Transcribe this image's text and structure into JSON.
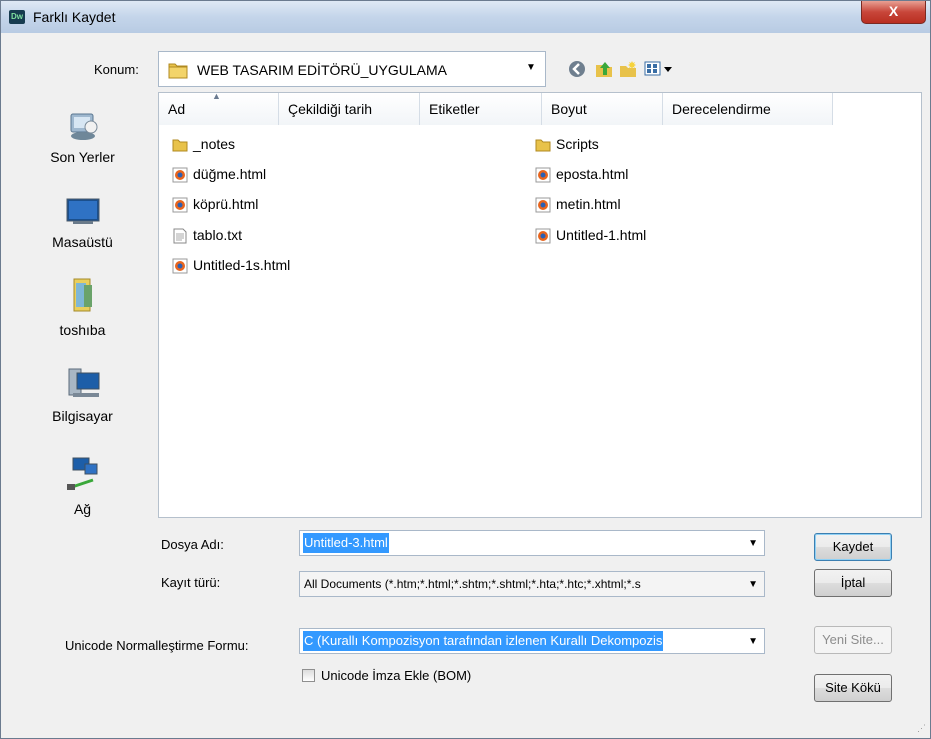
{
  "window": {
    "title": "Farklı Kaydet",
    "logo_text": "Dw",
    "close_glyph": "X"
  },
  "location": {
    "label": "Konum:",
    "value": "WEB TASARIM EDİTÖRÜ_UYGULAMA"
  },
  "toolbar_icons": [
    "back-icon",
    "up-folder-icon",
    "new-folder-icon",
    "view-menu-icon"
  ],
  "places": [
    {
      "label": "Son Yerler",
      "icon": "recent-places-icon"
    },
    {
      "label": "Masaüstü",
      "icon": "desktop-icon"
    },
    {
      "label": "toshıba",
      "icon": "user-folder-icon"
    },
    {
      "label": "Bilgisayar",
      "icon": "computer-icon"
    },
    {
      "label": "Ağ",
      "icon": "network-icon"
    }
  ],
  "columns": [
    "Ad",
    "Çekildiği tarih",
    "Etiketler",
    "Boyut",
    "Derecelendirme"
  ],
  "files": [
    {
      "name": "_notes",
      "type": "folder"
    },
    {
      "name": "düğme.html",
      "type": "html"
    },
    {
      "name": "köprü.html",
      "type": "html"
    },
    {
      "name": "tablo.txt",
      "type": "txt"
    },
    {
      "name": "Untitled-1s.html",
      "type": "html"
    },
    {
      "name": "Scripts",
      "type": "folder"
    },
    {
      "name": "eposta.html",
      "type": "html"
    },
    {
      "name": "metin.html",
      "type": "html"
    },
    {
      "name": "Untitled-1.html",
      "type": "html"
    }
  ],
  "form": {
    "filename_label": "Dosya Adı:",
    "filename_value": "Untitled-3.html",
    "filetype_label": "Kayıt türü:",
    "filetype_value": "All Documents (*.htm;*.html;*.shtm;*.shtml;*.hta;*.htc;*.xhtml;*.s",
    "unicode_label": "Unicode Normalleştirme Formu:",
    "unicode_value": "C (Kurallı Kompozisyon tarafından izlenen Kurallı Dekompozis",
    "bom_label": "Unicode İmza Ekle (BOM)",
    "bom_checked": false
  },
  "buttons": {
    "save": "Kaydet",
    "cancel": "İptal",
    "new_site": "Yeni Site...",
    "site_root": "Site Kökü"
  }
}
